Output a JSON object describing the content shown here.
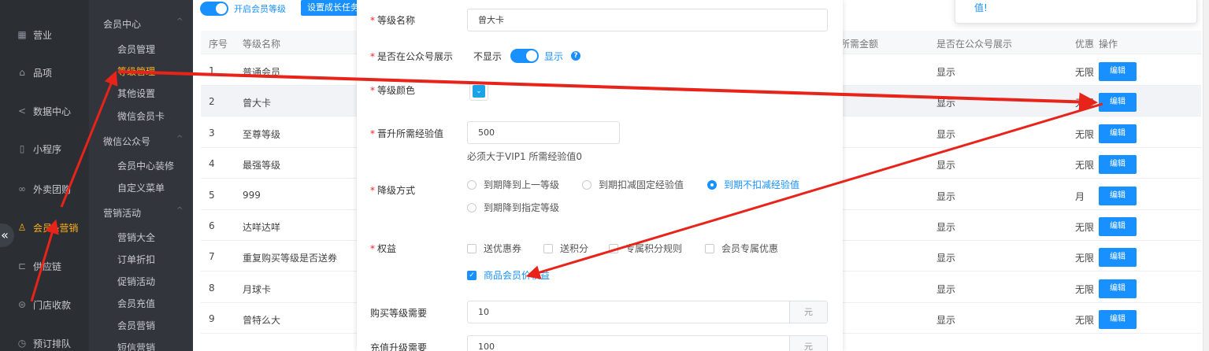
{
  "sidebar": {
    "items": [
      {
        "label": "营业",
        "icon": "calendar-icon"
      },
      {
        "label": "品项",
        "icon": "bag-icon"
      },
      {
        "label": "数据中心",
        "icon": "share-icon"
      },
      {
        "label": "小程序",
        "icon": "phone-icon"
      },
      {
        "label": "外卖团购",
        "icon": "bike-icon"
      },
      {
        "label": "会员&营销",
        "icon": "user-icon"
      },
      {
        "label": "供应链",
        "icon": "truck-icon"
      },
      {
        "label": "门店收款",
        "icon": "coins-icon"
      },
      {
        "label": "预订排队",
        "icon": "clock-icon"
      }
    ],
    "collapse_glyph": "«"
  },
  "submenu": {
    "group1": "会员中心",
    "group1_items": [
      "会员管理",
      "等级管理",
      "其他设置",
      "微信会员卡"
    ],
    "group2": "微信公众号",
    "group2_items": [
      "会员中心装修",
      "自定义菜单"
    ],
    "group3": "营销活动",
    "group3_items": [
      "营销大全",
      "订单折扣",
      "促销活动",
      "会员充值",
      "会员营销",
      "短信营销"
    ]
  },
  "topbar": {
    "switch_label": "开启会员等级",
    "grow_button": "设置成长任务"
  },
  "table": {
    "headers": {
      "index": "序号",
      "name": "等级名称",
      "amount": "所需金额",
      "show": "是否在公众号展示",
      "discount": "优惠",
      "op": "操作"
    },
    "edit_label": "编辑",
    "rows": [
      {
        "index": "1",
        "name": "普通会员",
        "show": "显示",
        "discount": "无限"
      },
      {
        "index": "2",
        "name": "曾大卡",
        "show": "显示",
        "discount": "无限"
      },
      {
        "index": "3",
        "name": "至尊等级",
        "show": "显示",
        "discount": "无限"
      },
      {
        "index": "4",
        "name": "最强等级",
        "show": "显示",
        "discount": "无限"
      },
      {
        "index": "5",
        "name": "999",
        "show": "显示",
        "discount": "月"
      },
      {
        "index": "6",
        "name": "达咩达咩",
        "show": "显示",
        "discount": "无限"
      },
      {
        "index": "7",
        "name": "重复购买等级是否送券",
        "show": "显示",
        "discount": "无限"
      },
      {
        "index": "8",
        "name": "月球卡",
        "show": "显示",
        "discount": "无限"
      },
      {
        "index": "9",
        "name": "曾特么大",
        "show": "显示",
        "discount": "无限"
      }
    ]
  },
  "modal": {
    "level_name_label": "等级名称",
    "level_name_value": "曾大卡",
    "show_label": "是否在公众号展示",
    "hide_text": "不显示",
    "show_text": "显示",
    "help_glyph": "?",
    "color_label": "等级颜色",
    "color_value": "#1aa3e8",
    "exp_label": "晋升所需经验值",
    "exp_value": "500",
    "exp_hint": "必须大于VIP1 所需经验值0",
    "downgrade_label": "降级方式",
    "downgrade_options": [
      "到期降到上一等级",
      "到期扣减固定经验值",
      "到期不扣减经验值",
      "到期降到指定等级"
    ],
    "downgrade_selected": "到期不扣减经验值",
    "rights_label": "权益",
    "rights_options": [
      "送优惠券",
      "送积分",
      "专属积分规则",
      "会员专属优惠",
      "商品会员价权益"
    ],
    "rights_checked": [
      "商品会员价权益"
    ],
    "buy_label": "购买等级需要",
    "buy_value": "10",
    "recharge_label": "充值升级需要",
    "recharge_value": "100",
    "unit": "元"
  },
  "notice": {
    "text": "值!"
  },
  "colors": {
    "accent": "#1890ff",
    "active_menu": "#ffb11b",
    "annotation": "#e8231a"
  }
}
